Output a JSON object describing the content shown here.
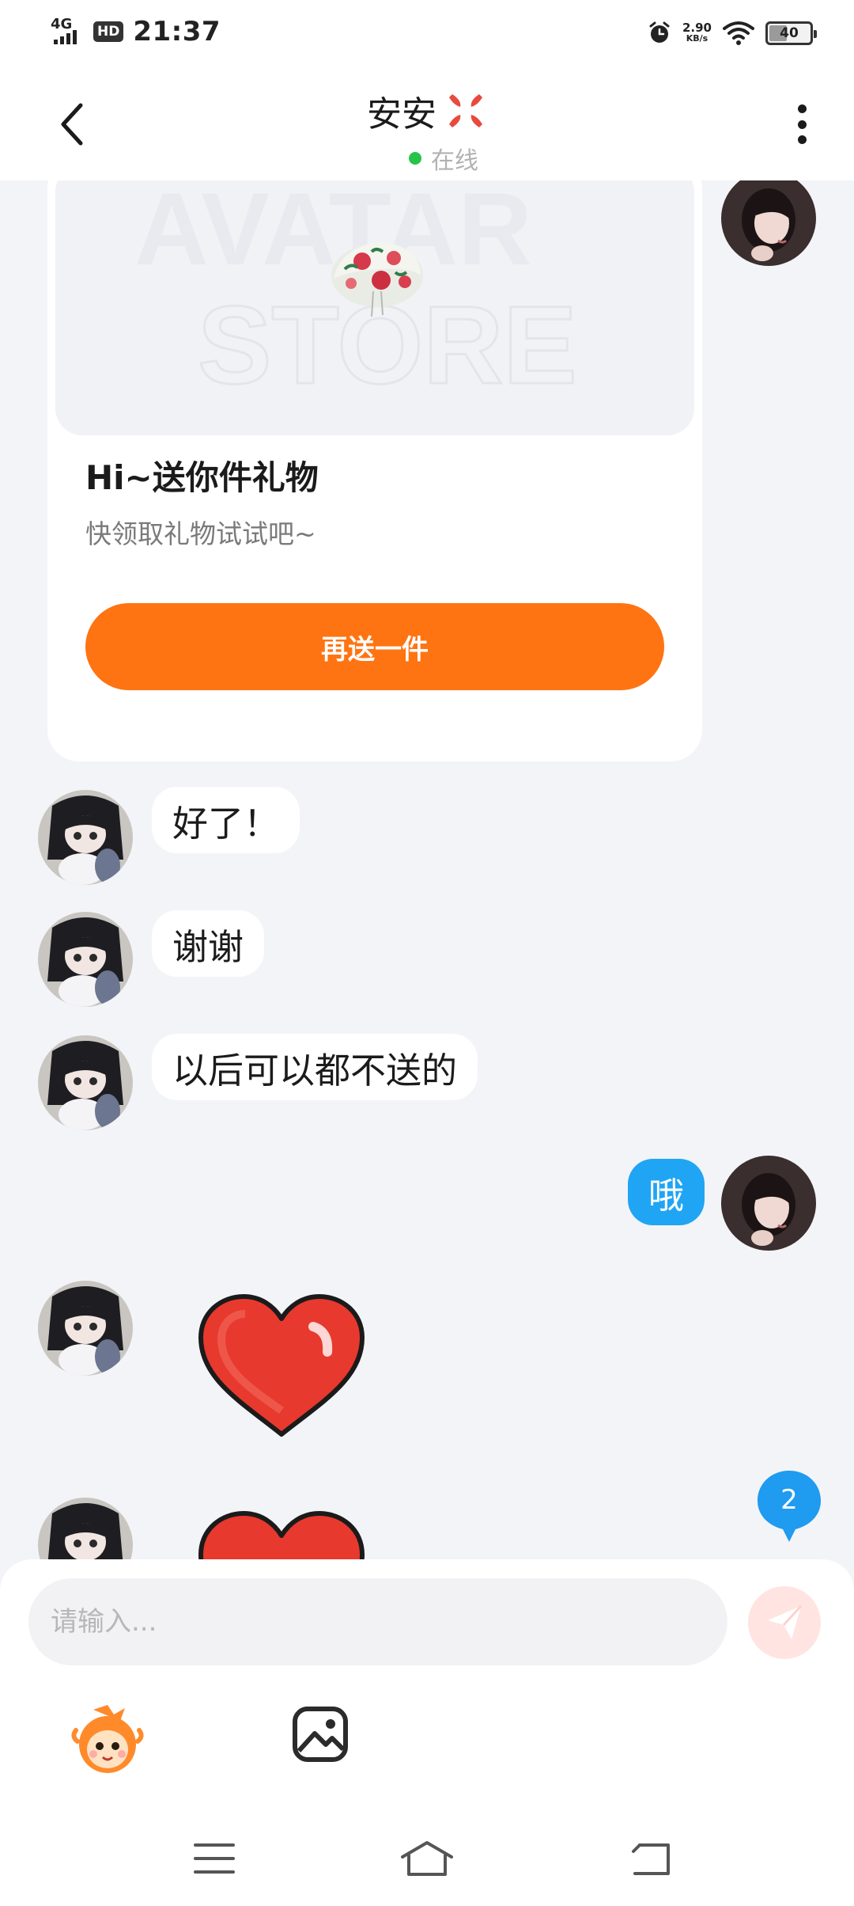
{
  "status_bar": {
    "network": "4G",
    "hd": "HD",
    "time": "21:37",
    "speed_value": "2.90",
    "speed_unit": "KB/s",
    "battery": "40",
    "icons": [
      "signal-icon",
      "alarm-icon",
      "wifi-icon",
      "battery-icon"
    ]
  },
  "header": {
    "contact_name": "安安",
    "status": "在线",
    "status_color": "#26c34b",
    "icons": [
      "back-icon",
      "anger-icon",
      "more-icon"
    ]
  },
  "gift_card": {
    "watermark_line1": "AVATAR",
    "watermark_line2": "STORE",
    "title": "Hi~送你件礼物",
    "subtitle": "快领取礼物试试吧~",
    "button_label": "再送一件",
    "button_color": "#ff7412"
  },
  "messages": [
    {
      "from": "contact",
      "type": "text",
      "text": "好了！"
    },
    {
      "from": "contact",
      "type": "text",
      "text": "谢谢"
    },
    {
      "from": "contact",
      "type": "text",
      "text": "以后可以都不送的"
    },
    {
      "from": "me",
      "type": "text",
      "text": "哦"
    },
    {
      "from": "contact",
      "type": "sticker",
      "sticker": "heart-sticker"
    },
    {
      "from": "contact",
      "type": "sticker",
      "sticker": "heart-sticker"
    }
  ],
  "unread_count": "2",
  "composer": {
    "placeholder": "请输入...",
    "send_color": "#ffe4e1",
    "tools": [
      "emoji-icon",
      "image-icon"
    ]
  },
  "navigation": [
    "menu-icon",
    "home-icon",
    "back-nav-icon"
  ],
  "colors": {
    "accent_orange": "#ff7412",
    "my_bubble": "#1fa5f4",
    "background": "#f3f4f8"
  }
}
